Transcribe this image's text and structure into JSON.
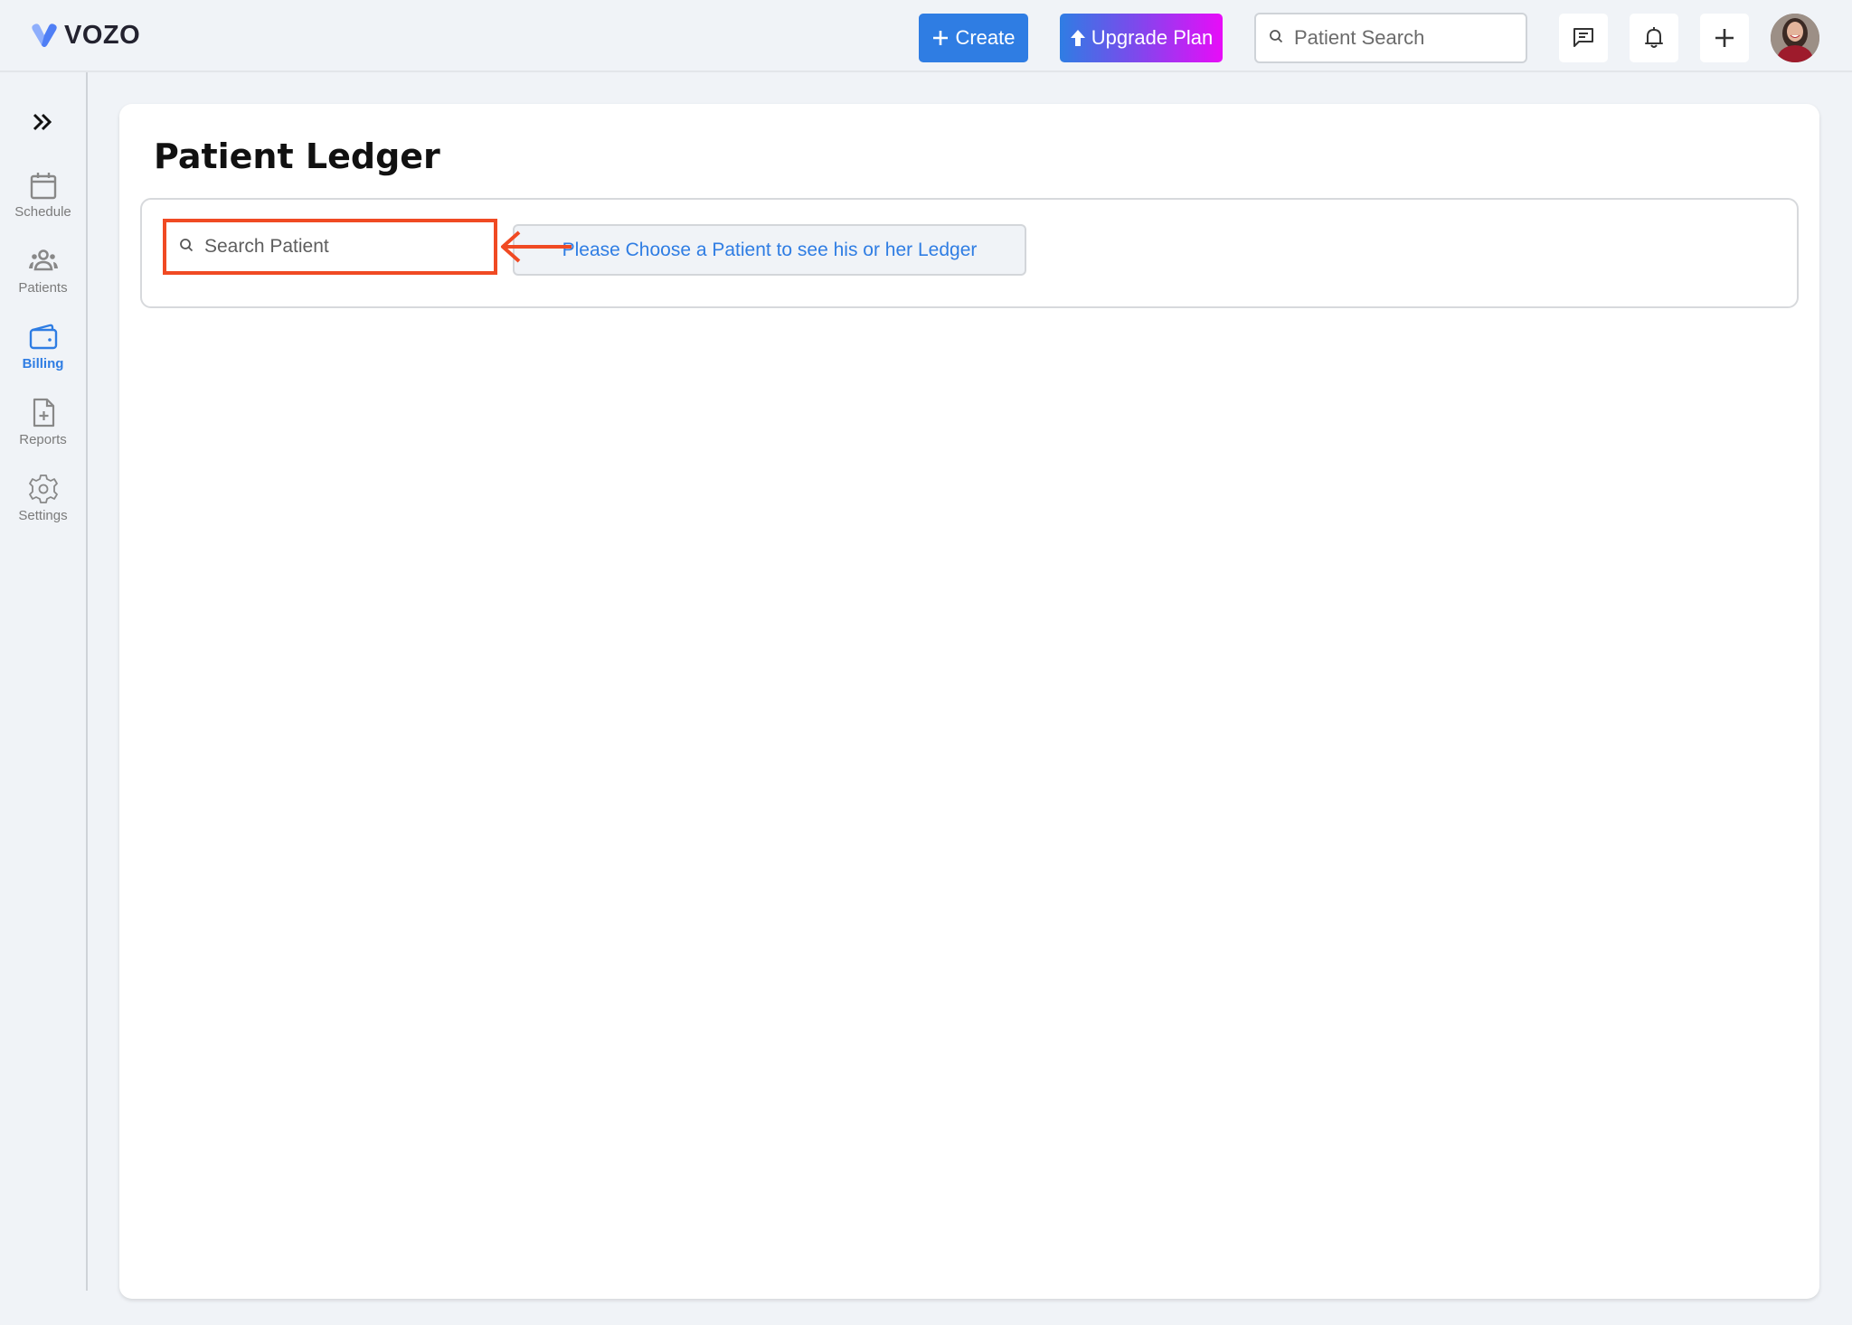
{
  "header": {
    "logo_text": "VOZO",
    "create_label": "Create",
    "upgrade_label": "Upgrade Plan",
    "search_placeholder": "Patient Search",
    "icons": {
      "create": "plus-icon",
      "upgrade": "arrow-up-icon",
      "search": "search-icon",
      "messages": "message-icon",
      "notifications": "bell-icon",
      "add": "plus-icon",
      "avatar": "user-avatar"
    }
  },
  "sidebar": {
    "expand_icon": "double-chevron-right-icon",
    "items": [
      {
        "label": "Schedule",
        "icon": "calendar-icon",
        "active": false
      },
      {
        "label": "Patients",
        "icon": "users-icon",
        "active": false
      },
      {
        "label": "Billing",
        "icon": "wallet-icon",
        "active": true
      },
      {
        "label": "Reports",
        "icon": "file-plus-icon",
        "active": false
      },
      {
        "label": "Settings",
        "icon": "gear-icon",
        "active": false
      }
    ]
  },
  "main": {
    "title": "Patient Ledger",
    "search_placeholder": "Search Patient",
    "info_message": "Please Choose a Patient to see his or her Ledger"
  },
  "colors": {
    "primary": "#2f7de3",
    "highlight": "#f04a23",
    "gradient_end": "#e80cf8",
    "background": "#f0f3f7"
  }
}
